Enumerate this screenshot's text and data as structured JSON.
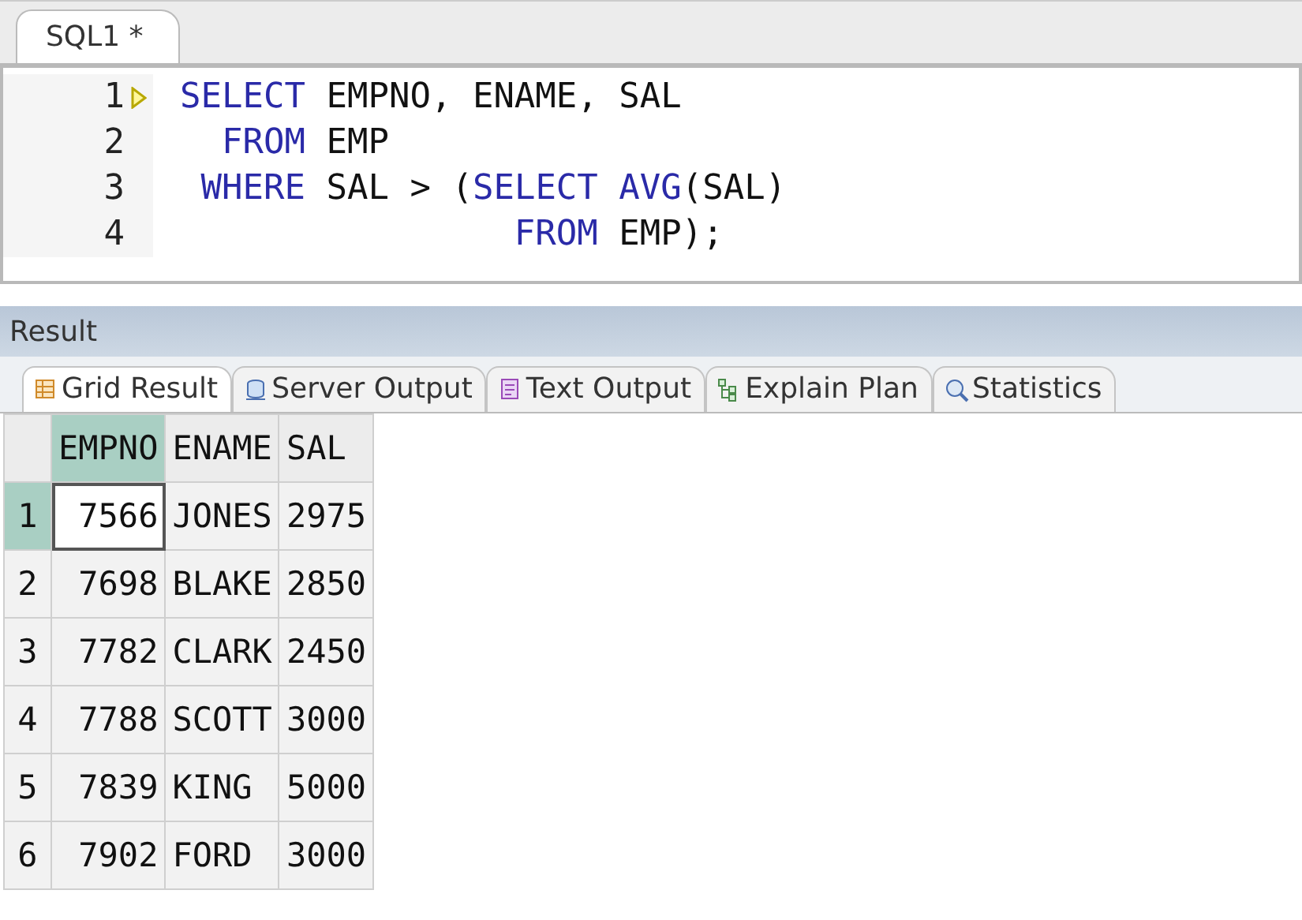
{
  "editor_tab": {
    "label": "SQL1 *"
  },
  "editor": {
    "lines": [
      {
        "number": "1",
        "current": true,
        "tokens": [
          {
            "kind": "keyword",
            "text": "SELECT"
          },
          {
            "kind": "plain",
            "text": " EMPNO, ENAME, SAL"
          }
        ]
      },
      {
        "number": "2",
        "current": false,
        "tokens": [
          {
            "kind": "keyword",
            "text": "  FROM"
          },
          {
            "kind": "plain",
            "text": " EMP"
          }
        ]
      },
      {
        "number": "3",
        "current": false,
        "tokens": [
          {
            "kind": "keyword",
            "text": " WHERE"
          },
          {
            "kind": "plain",
            "text": " SAL > ("
          },
          {
            "kind": "keyword",
            "text": "SELECT AVG"
          },
          {
            "kind": "plain",
            "text": "(SAL)"
          }
        ]
      },
      {
        "number": "4",
        "current": false,
        "tokens": [
          {
            "kind": "keyword",
            "text": "                FROM"
          },
          {
            "kind": "plain",
            "text": " EMP);"
          }
        ]
      }
    ]
  },
  "result_panel": {
    "title": "Result"
  },
  "tabs": [
    {
      "label": "Grid Result",
      "kind": "grid",
      "selected": true
    },
    {
      "label": "Server Output",
      "kind": "server",
      "selected": false
    },
    {
      "label": "Text Output",
      "kind": "text",
      "selected": false
    },
    {
      "label": "Explain Plan",
      "kind": "plan",
      "selected": false
    },
    {
      "label": "Statistics",
      "kind": "stats",
      "selected": false
    }
  ],
  "table": {
    "columns": [
      {
        "label": "EMPNO",
        "selected": true,
        "kind": "number"
      },
      {
        "label": "ENAME",
        "selected": false,
        "kind": "text"
      },
      {
        "label": "SAL",
        "selected": false,
        "kind": "number"
      }
    ],
    "rows": [
      {
        "number": "1",
        "selected": true,
        "cells": [
          "7566",
          "JONES",
          "2975"
        ]
      },
      {
        "number": "2",
        "selected": false,
        "cells": [
          "7698",
          "BLAKE",
          "2850"
        ]
      },
      {
        "number": "3",
        "selected": false,
        "cells": [
          "7782",
          "CLARK",
          "2450"
        ]
      },
      {
        "number": "4",
        "selected": false,
        "cells": [
          "7788",
          "SCOTT",
          "3000"
        ]
      },
      {
        "number": "5",
        "selected": false,
        "cells": [
          "7839",
          "KING",
          "5000"
        ]
      },
      {
        "number": "6",
        "selected": false,
        "cells": [
          "7902",
          "FORD",
          "3000"
        ]
      }
    ]
  }
}
